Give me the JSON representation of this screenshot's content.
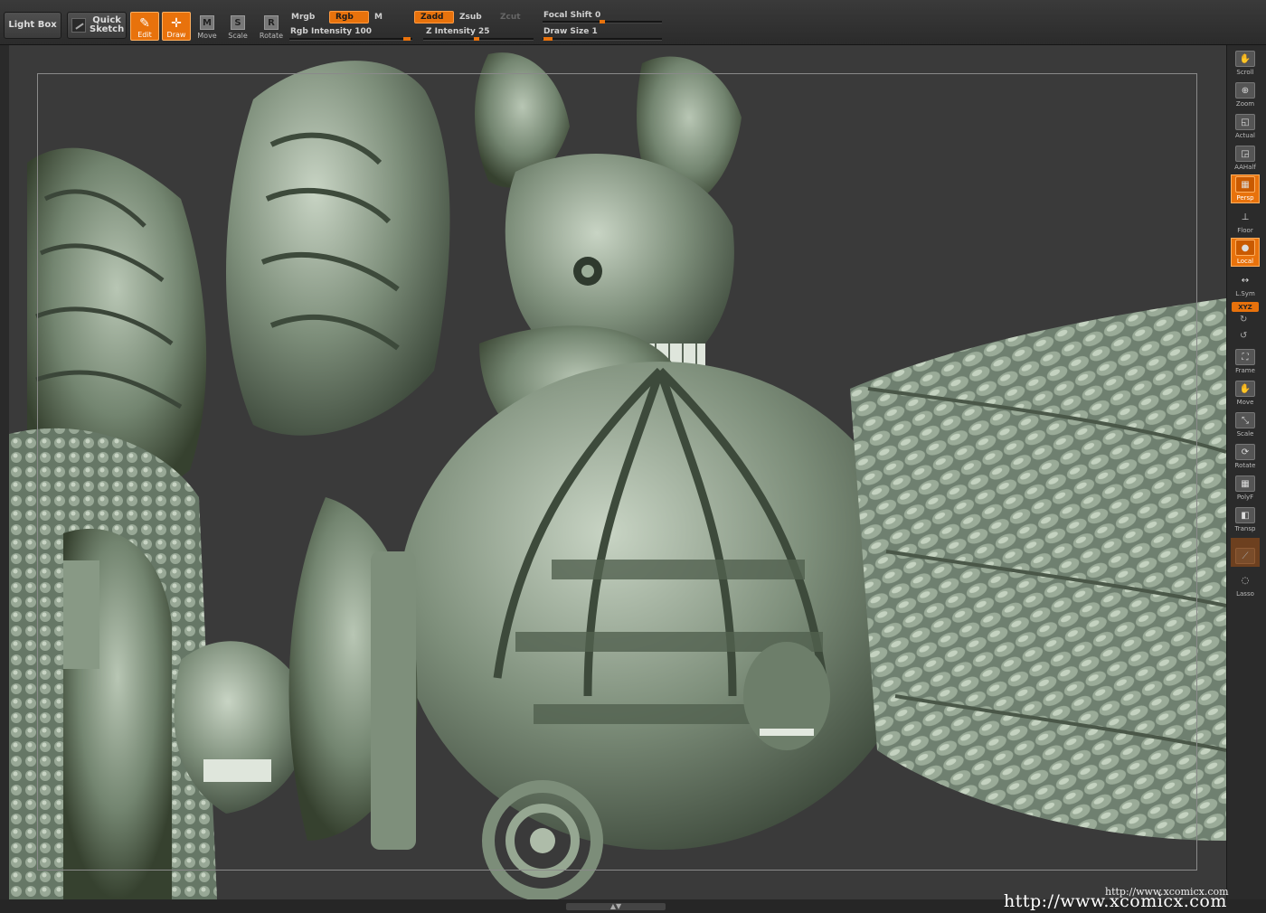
{
  "toolbar": {
    "lightbox_label": "Light Box",
    "quicksketch_label_1": "Quick",
    "quicksketch_label_2": "Sketch",
    "tools": [
      {
        "label": "Edit",
        "glyph": "✎",
        "active": true
      },
      {
        "label": "Draw",
        "glyph": "✛",
        "active": true
      },
      {
        "label": "Move",
        "glyph": "M",
        "active": false
      },
      {
        "label": "Scale",
        "glyph": "S",
        "active": false
      },
      {
        "label": "Rotate",
        "glyph": "R",
        "active": false
      }
    ],
    "mrgb": "Mrgb",
    "rgb": "Rgb",
    "m": "M",
    "zadd": "Zadd",
    "zsub": "Zsub",
    "zcut": "Zcut",
    "rgb_intensity_label": "Rgb Intensity",
    "rgb_intensity_value": "100",
    "z_intensity_label": "Z Intensity",
    "z_intensity_value": "25",
    "focal_shift_label": "Focal Shift",
    "focal_shift_value": "0",
    "draw_size_label": "Draw Size",
    "draw_size_value": "1"
  },
  "shelf": {
    "scroll": "Scroll",
    "zoom": "Zoom",
    "actual": "Actual",
    "aahalf": "AAHalf",
    "persp": "Persp",
    "floor": "Floor",
    "local": "Local",
    "lsym": "L.Sym",
    "xyz": "XYZ",
    "frame": "Frame",
    "move": "Move",
    "scale": "Scale",
    "rotate": "Rotate",
    "polyf": "PolyF",
    "transp": "Transp",
    "lasso": "Lasso"
  },
  "watermark": {
    "small": "http://www.xcomicx.com",
    "large": "http://www.xcomicx.com"
  },
  "colors": {
    "accent": "#e8720c",
    "background": "#3a3a3a",
    "model": "#8a9a88"
  }
}
